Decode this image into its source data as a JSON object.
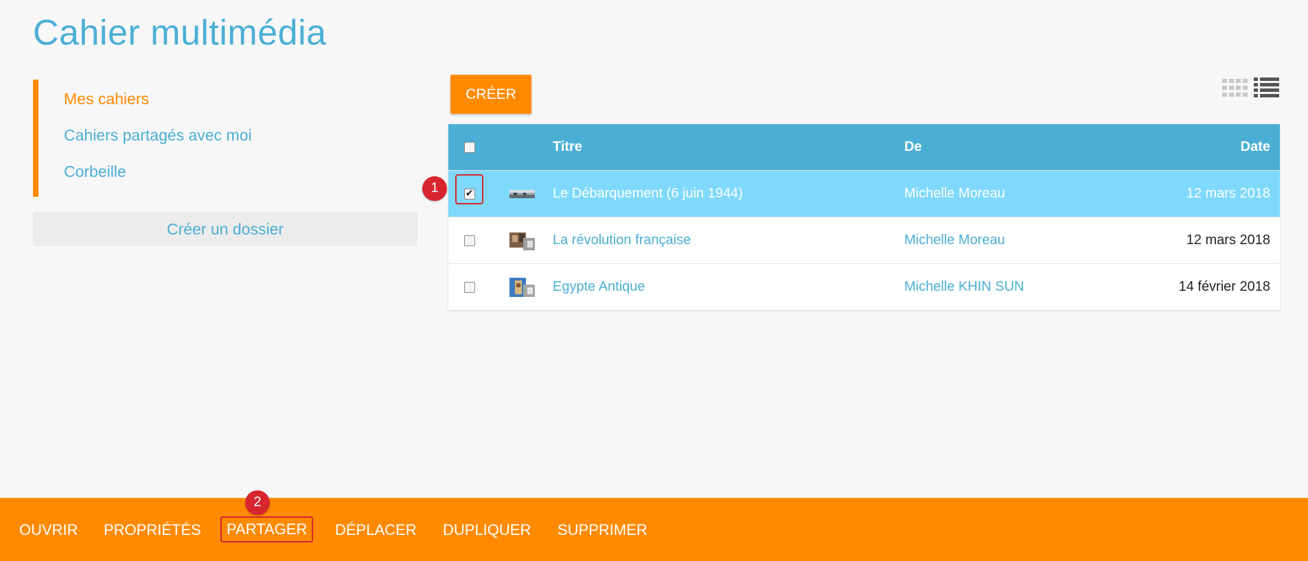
{
  "page": {
    "title": "Cahier multimédia"
  },
  "sidebar": {
    "items": [
      {
        "label": "Mes cahiers",
        "active": true
      },
      {
        "label": "Cahiers partagés avec moi",
        "active": false
      },
      {
        "label": "Corbeille",
        "active": false
      }
    ],
    "new_folder_label": "Créer un dossier"
  },
  "toolbar": {
    "create_label": "CRÉER",
    "view_icons": [
      "grid-view-icon",
      "list-view-icon"
    ]
  },
  "table": {
    "headers": {
      "title": "Titre",
      "from": "De",
      "date": "Date"
    },
    "rows": [
      {
        "title": "Le Débarquement (6 juin 1944)",
        "from": "Michelle Moreau",
        "date": "12 mars 2018",
        "checked": true
      },
      {
        "title": "La révolution française",
        "from": "Michelle Moreau",
        "date": "12 mars 2018",
        "checked": false
      },
      {
        "title": "Egypte Antique",
        "from": "Michelle KHIN SUN",
        "date": "14 février 2018",
        "checked": false
      }
    ]
  },
  "annotations": {
    "step1": "1",
    "step2": "2"
  },
  "actions": {
    "open": "OUVRIR",
    "properties": "PROPRIÉTÉS",
    "share": "PARTAGER",
    "move": "DÉPLACER",
    "duplicate": "DUPLIQUER",
    "delete": "SUPPRIMER"
  },
  "colors": {
    "accent": "#ff8a00",
    "primary": "#4bafd5",
    "selected_row": "#7fd9fd",
    "annotation": "#d8262e"
  }
}
